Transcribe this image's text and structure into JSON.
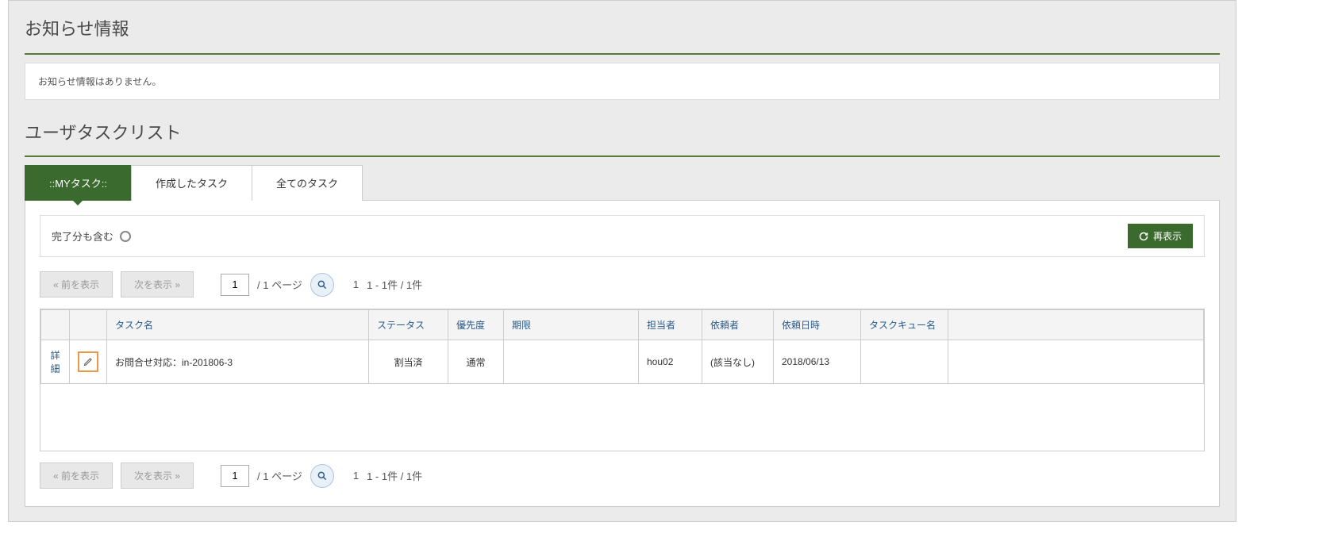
{
  "notice": {
    "title": "お知らせ情報",
    "message": "お知らせ情報はありません。"
  },
  "tasklist": {
    "title": "ユーザタスクリスト",
    "tabs": [
      {
        "label": "::MYタスク::",
        "active": true
      },
      {
        "label": "作成したタスク",
        "active": false
      },
      {
        "label": "全てのタスク",
        "active": false
      }
    ],
    "filter": {
      "include_completed_label": "完了分も含む",
      "reload_label": "再表示"
    },
    "pagination": {
      "prev_label": "«   前を表示",
      "next_label": "次を表示   »",
      "page_value": "1",
      "page_total_label": "/  1 ページ",
      "count_page": "1",
      "count_range": "1 - 1件 / 1件"
    },
    "columns": {
      "task_name": "タスク名",
      "status": "ステータス",
      "priority": "優先度",
      "deadline": "期限",
      "assignee": "担当者",
      "requester": "依頼者",
      "request_date": "依頼日時",
      "queue_name": "タスクキュー名"
    },
    "rows": [
      {
        "detail_label": "詳細",
        "task_name": "お問合せ対応：in-201806-3",
        "status": "割当済",
        "priority": "通常",
        "deadline": "",
        "assignee": "hou02",
        "requester": "(該当なし)",
        "request_date": "2018/06/13",
        "queue_name": ""
      }
    ]
  }
}
